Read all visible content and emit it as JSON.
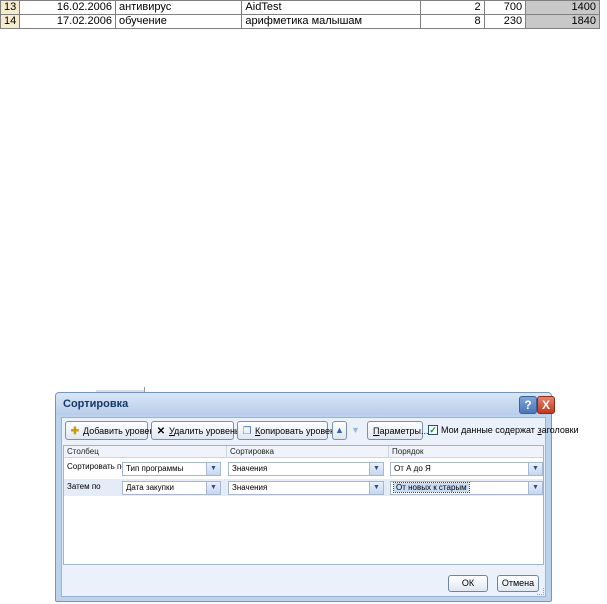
{
  "sheet": {
    "rows": [
      {
        "num": "13",
        "date": "16.02.2006",
        "type": "антивирус",
        "name": "AidTest",
        "qty": "2",
        "price": "700",
        "sum": "1400"
      },
      {
        "num": "14",
        "date": "17.02.2006",
        "type": "обучение",
        "name": "арифметика малышам",
        "qty": "8",
        "price": "230",
        "sum": "1840"
      }
    ]
  },
  "dialog": {
    "title": "Сортировка",
    "help_label": "?",
    "close_label": "X",
    "toolbar": {
      "add_pre": "",
      "add_u": "Д",
      "add_post": "обавить уровень",
      "delete_pre": "",
      "delete_u": "У",
      "delete_post": "далить уровень",
      "copy_pre": "",
      "copy_u": "К",
      "copy_post": "опировать уровень",
      "params_u": "П",
      "params_post": "араметры...",
      "headers_pre": "Мои данные содержат ",
      "headers_u": "з",
      "headers_post": "аголовки",
      "headers_checked": "✓"
    },
    "columns": {
      "column": "Столбец",
      "sort": "Сортировка",
      "order": "Порядок"
    },
    "levels": [
      {
        "label": "Сортировать по",
        "column": "Тип программы",
        "sort_on": "Значения",
        "order": "От А до Я"
      },
      {
        "label": "Затем по",
        "column": "Дата закупки",
        "sort_on": "Значения",
        "order": "От новых к старым"
      }
    ],
    "ok_label": "ОК",
    "cancel_label": "Отмена"
  },
  "icons": {
    "add": "add-level-icon",
    "delete": "delete-level-icon",
    "copy": "copy-level-icon",
    "up": "move-up-icon",
    "down": "move-down-icon",
    "dropdown": "chevron-down-icon"
  },
  "colors": {
    "title_bar": "#b7cdea",
    "close_button": "#c2391c",
    "selected_cell": "#c9dcf6",
    "sum_column": "#c8c8c8",
    "row_header": "#f4eccd"
  }
}
